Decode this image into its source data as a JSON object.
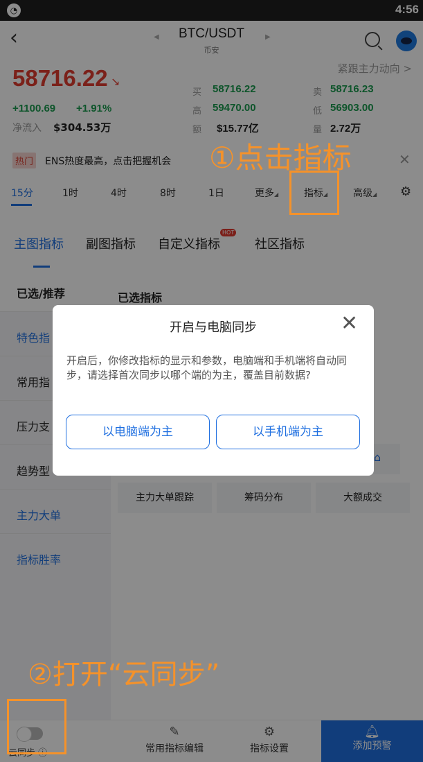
{
  "status_bar": {
    "time": "4:56"
  },
  "header": {
    "pair": "BTC/USDT",
    "exchange": "币安"
  },
  "market": {
    "follow_link": "紧跟主力动向 >",
    "price": "58716.22",
    "price_arrow": "↘",
    "change": "+1100.69",
    "change_pct": "+1.91%",
    "net_inflow_label": "净流入",
    "net_inflow_value": "$304.53万",
    "stats": {
      "buy_label": "买",
      "buy_value": "58716.22",
      "sell_label": "卖",
      "sell_value": "58716.23",
      "high_label": "高",
      "high_value": "59470.00",
      "low_label": "低",
      "low_value": "56903.00",
      "amount_label": "额",
      "amount_value": "$15.77亿",
      "volume_label": "量",
      "volume_value": "2.72万"
    }
  },
  "hot_banner": {
    "badge": "热门",
    "text": "ENS热度最高，点击把握机会"
  },
  "time_tabs": [
    "15分",
    "1时",
    "4时",
    "8时",
    "1日",
    "更多",
    "指标",
    "高级"
  ],
  "indicator_tabs": [
    "主图指标",
    "副图指标",
    "自定义指标",
    "社区指标"
  ],
  "hot_tag": "HOT",
  "left_nav": [
    "已选/推荐",
    "特色指",
    "常用指",
    "压力支",
    "趋势型",
    "主力大单",
    "指标胜率"
  ],
  "content": {
    "selected_title": "已选指标",
    "chips": [
      "主力大单跟踪",
      "筹码分布",
      "大额成交"
    ]
  },
  "bottom_bar": {
    "cloud_sync": "云同步 ⓘ",
    "edit_indicators": "常用指标编辑",
    "indicator_settings": "指标设置",
    "add_alert": "添加预警"
  },
  "dialog": {
    "title": "开启与电脑同步",
    "body": "开启后，你修改指标的显示和参数，电脑端和手机端将自动同步，请选择首次同步以哪个端的为主，覆盖目前数据?",
    "btn_pc": "以电脑端为主",
    "btn_mobile": "以手机端为主"
  },
  "annotations": {
    "step1": "①点击指标",
    "step2": "②打开“云同步”"
  },
  "colors": {
    "accent": "#1f6fe0",
    "down_red": "#e03c31",
    "up_green": "#1a9b4f",
    "annotation": "#f5922a"
  }
}
